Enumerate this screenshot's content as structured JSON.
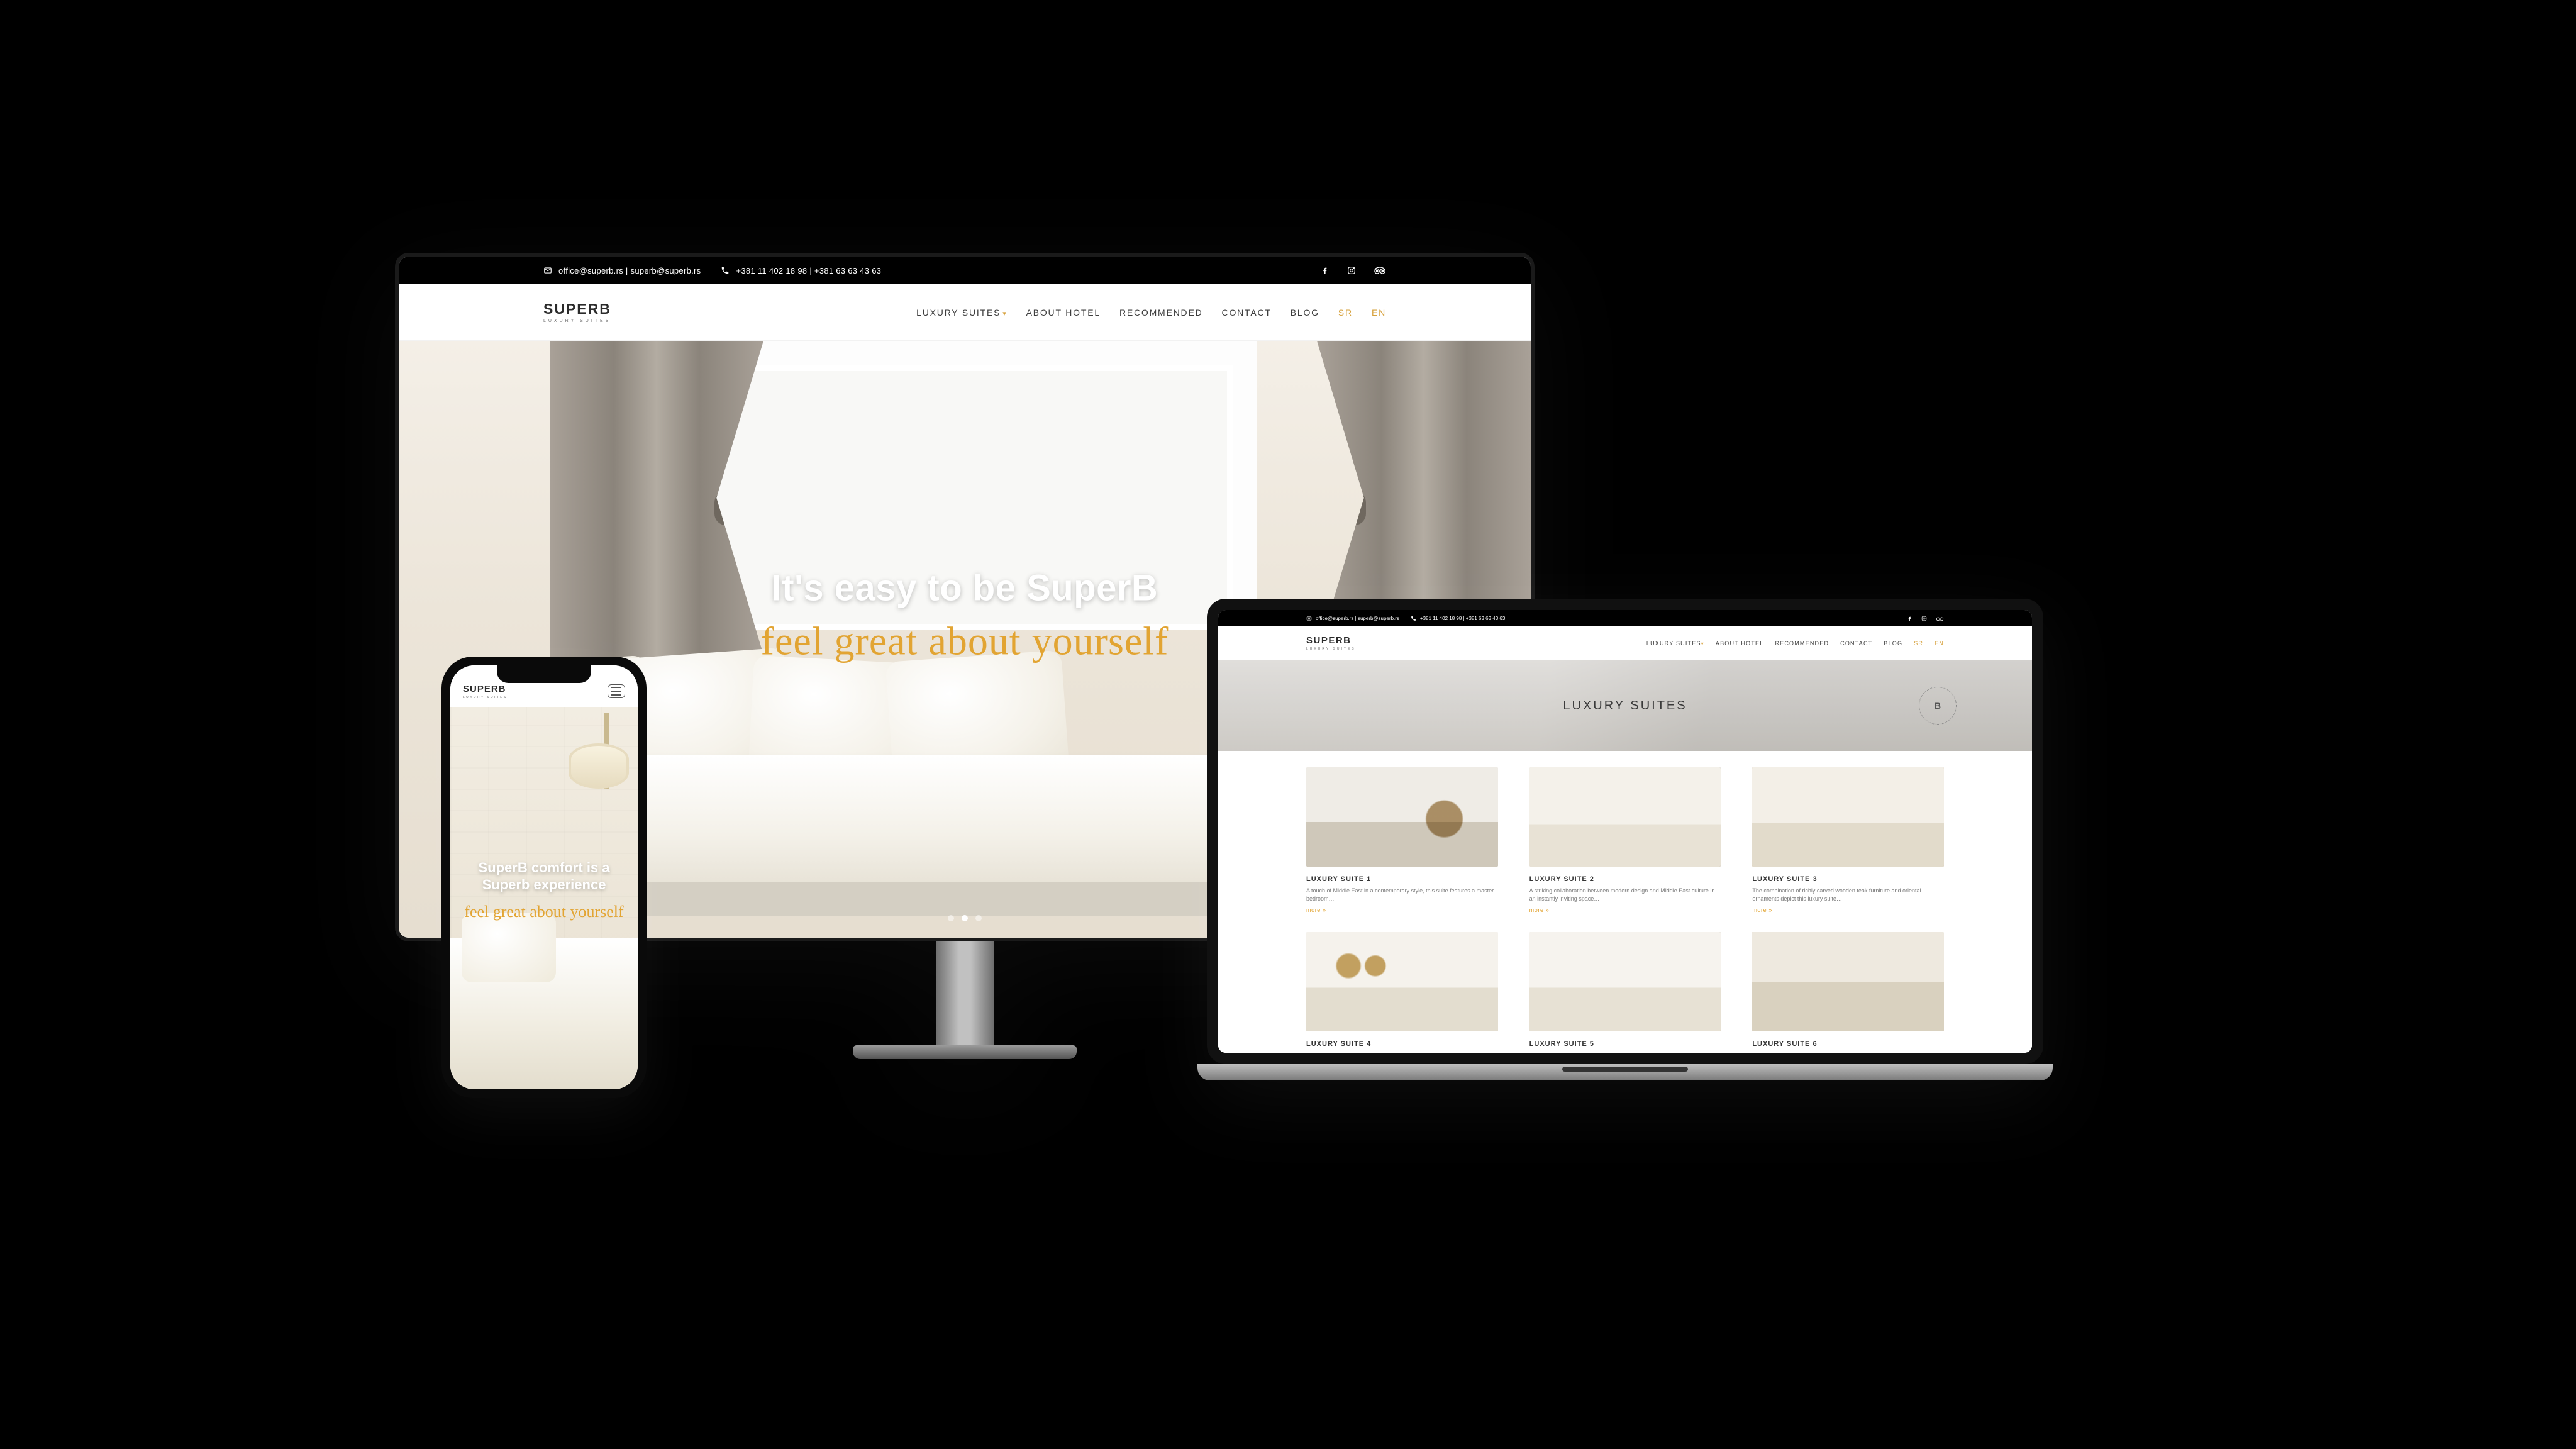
{
  "brand": {
    "name": "SUPERB",
    "tagline": "LUXURY SUITES"
  },
  "contact": {
    "emails": "office@superb.rs | superb@superb.rs",
    "phones": "+381 11 402 18 98 | +381 63 63 43 63"
  },
  "socials": [
    "facebook",
    "instagram",
    "tripadvisor"
  ],
  "nav": {
    "items": [
      {
        "label": "LUXURY SUITES",
        "hasDropdown": true
      },
      {
        "label": "ABOUT HOTEL"
      },
      {
        "label": "RECOMMENDED"
      },
      {
        "label": "CONTACT"
      },
      {
        "label": "BLOG"
      }
    ],
    "langs": [
      {
        "label": "SR"
      },
      {
        "label": "EN"
      }
    ]
  },
  "desktopHero": {
    "line1": "It's easy to be SuperB",
    "line2": "feel great about yourself",
    "activeDot": 1,
    "dotCount": 3
  },
  "laptop": {
    "pageTitle": "LUXURY SUITES",
    "stamp": "B",
    "moreLabel": "more »",
    "suites": [
      {
        "title": "LUXURY SUITE 1",
        "desc": "A touch of Middle East in a contemporary style, this suite features a master bedroom…",
        "img": "r1"
      },
      {
        "title": "LUXURY SUITE 2",
        "desc": "A striking collaboration between modern design and Middle East culture in an instantly inviting space…",
        "img": "r2"
      },
      {
        "title": "LUXURY SUITE 3",
        "desc": "The combination of richly carved wooden teak furniture and oriental ornaments depict this luxury suite…",
        "img": "r3"
      },
      {
        "title": "LUXURY SUITE 4",
        "desc": "",
        "img": "r4"
      },
      {
        "title": "LUXURY SUITE 5",
        "desc": "",
        "img": "r5"
      },
      {
        "title": "LUXURY SUITE 6",
        "desc": "",
        "img": "r6"
      }
    ]
  },
  "phoneHero": {
    "line1": "SuperB comfort is a Superb experience",
    "line2": "feel great about yourself"
  }
}
